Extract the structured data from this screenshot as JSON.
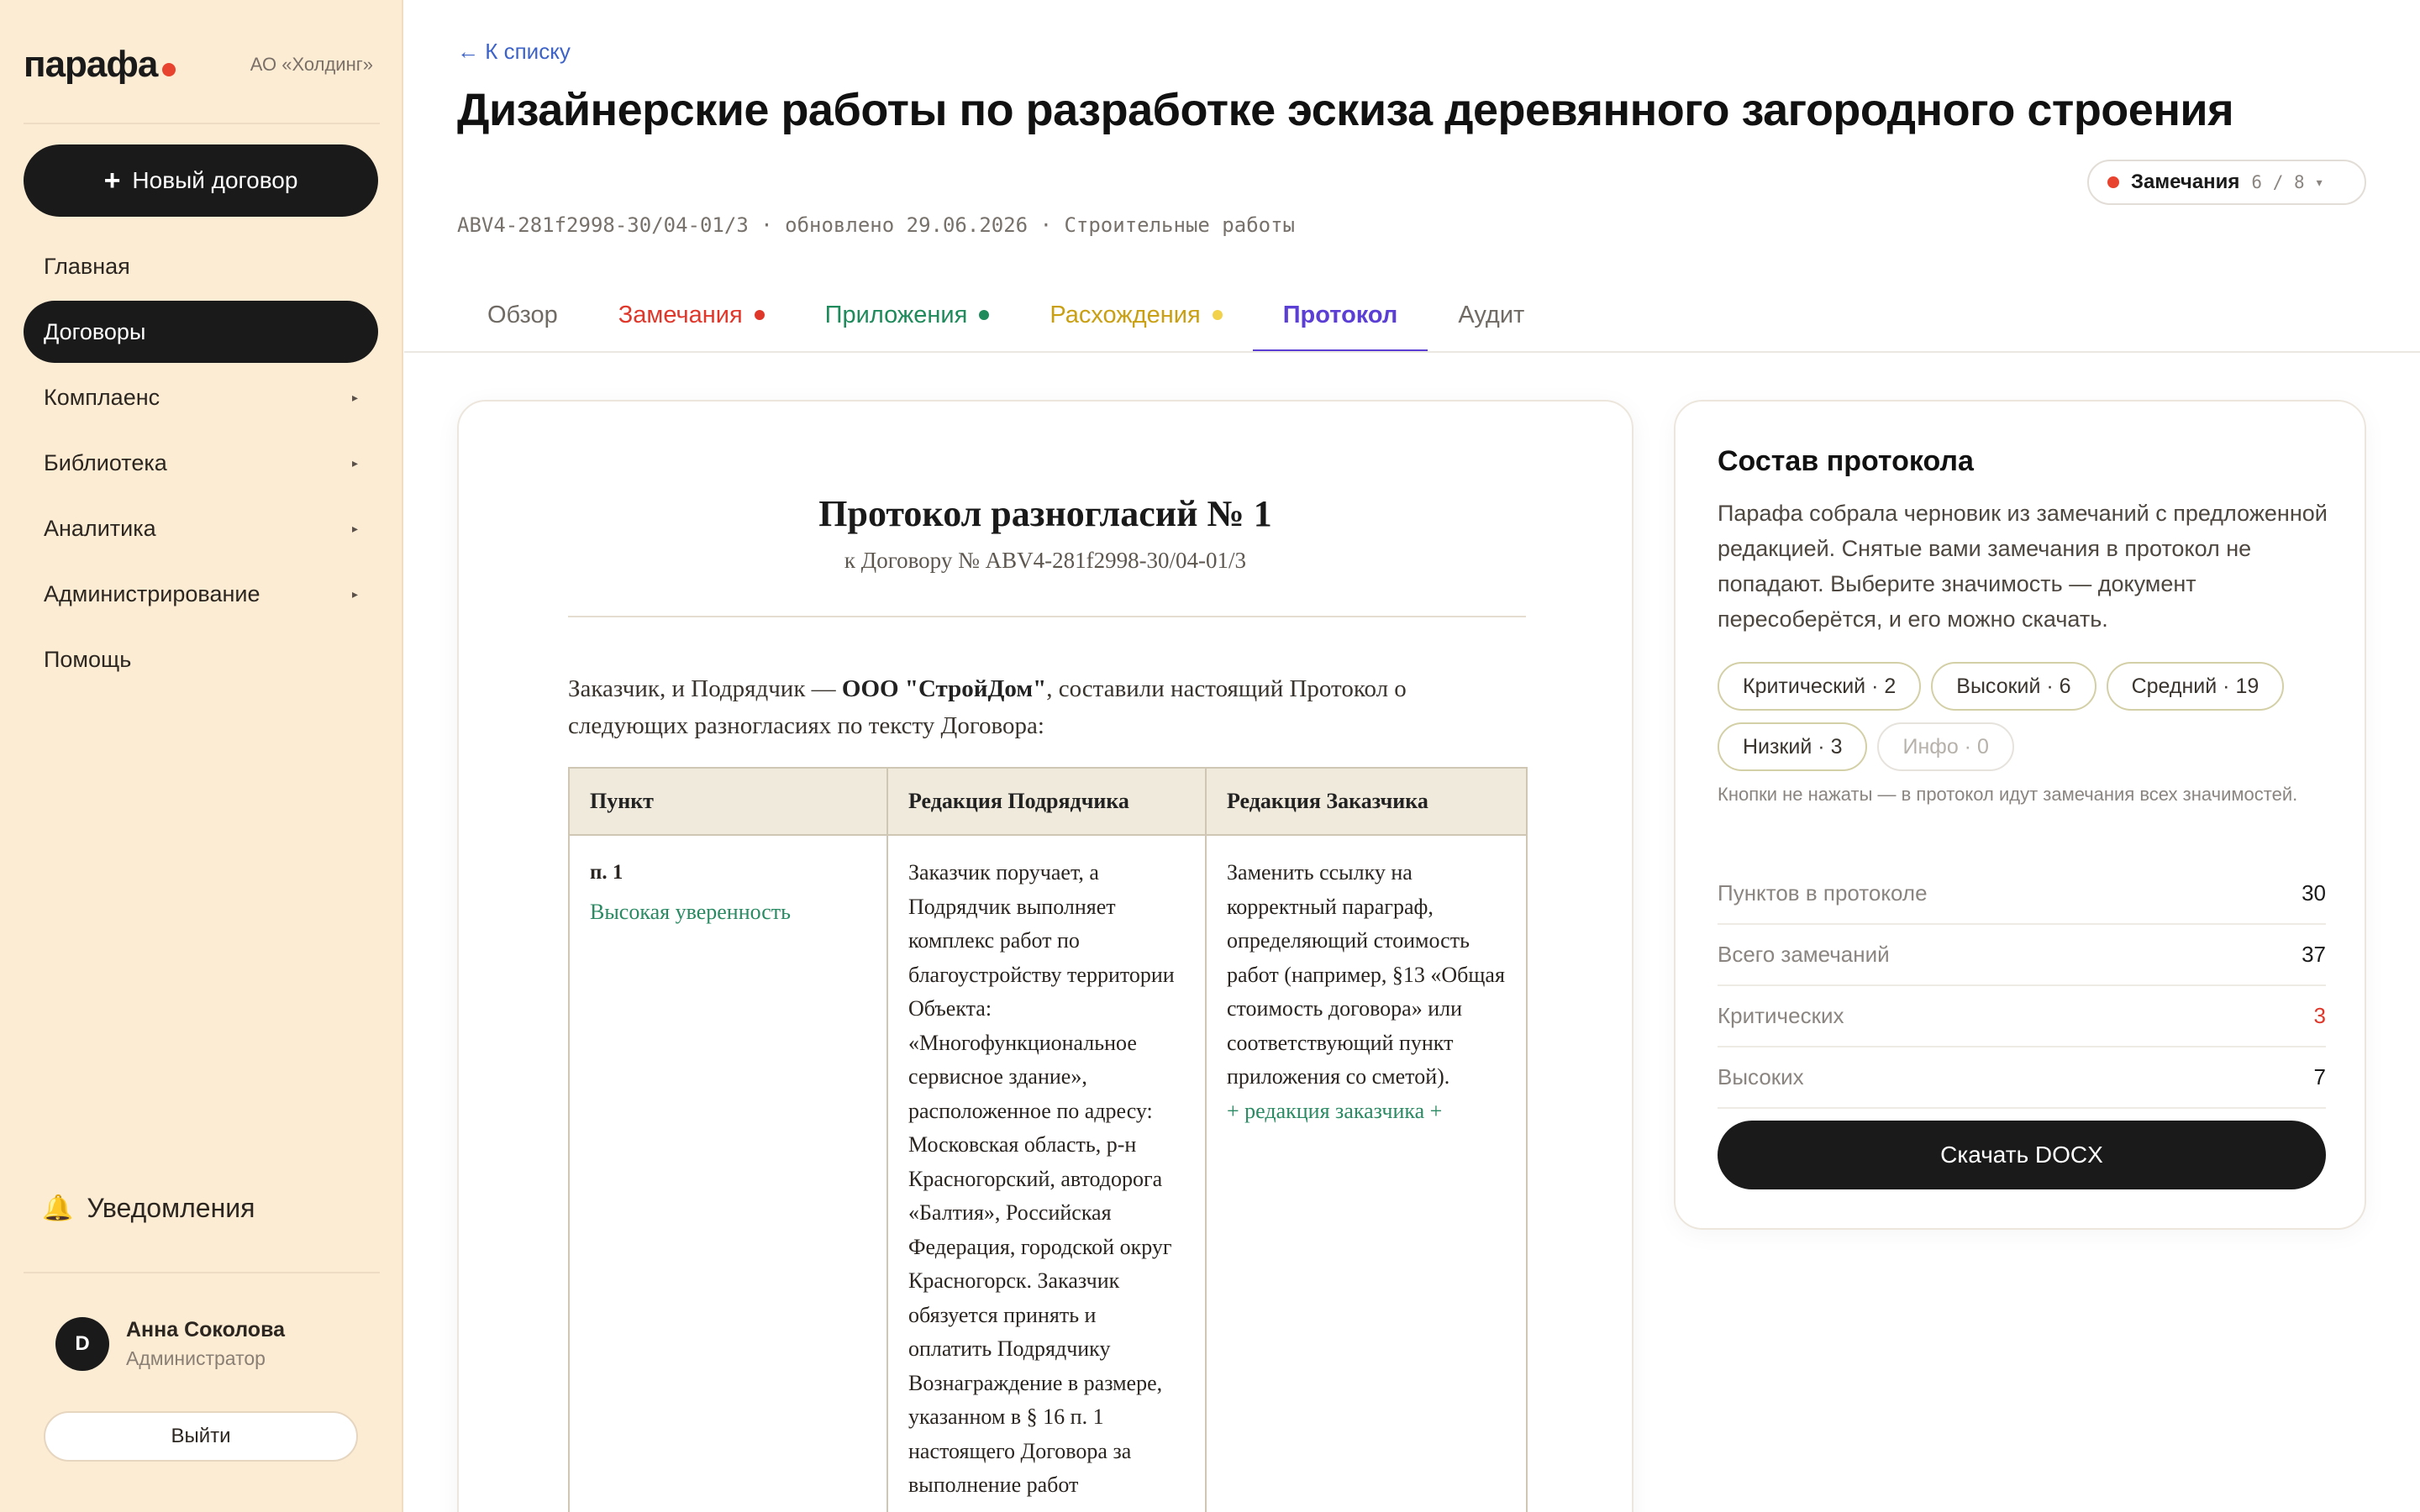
{
  "sidebar": {
    "logo": "парафа",
    "org": "АО «Холдинг»",
    "new_contract_label": "Новый договор",
    "items": [
      {
        "label": "Главная"
      },
      {
        "label": "Договоры"
      },
      {
        "label": "Комплаенс"
      },
      {
        "label": "Библиотека"
      },
      {
        "label": "Аналитика"
      },
      {
        "label": "Администрирование"
      },
      {
        "label": "Помощь"
      }
    ],
    "notifications_label": "Уведомления",
    "user": {
      "initial": "D",
      "name": "Анна Соколова",
      "role": "Администратор"
    },
    "logout_label": "Выйти"
  },
  "header": {
    "back_label": "← К списку",
    "title": "Дизайнерские работы по разработке эскиза деревянного загородного строения",
    "remarks_pill": {
      "label": "Замечания",
      "count": "6 / 8"
    },
    "meta": "ABV4-281f2998-30/04-01/3 · обновлено 29.06.2026 · Строительные работы"
  },
  "tabs": [
    {
      "label": "Обзор"
    },
    {
      "label": "Замечания"
    },
    {
      "label": "Приложения"
    },
    {
      "label": "Расхождения"
    },
    {
      "label": "Протокол"
    },
    {
      "label": "Аудит"
    }
  ],
  "colors": {
    "accent": "#5b3fd4",
    "tab_remarks": "#e0372b",
    "tab_attachments": "#1f8a5b",
    "tab_discrepancies": "#c9a013",
    "tab_discrepancies_dot": "#f2d24a",
    "sidebar_bg": "#fdecd4"
  },
  "document": {
    "title": "Протокол разногласий № 1",
    "subtitle": "к Договору № ABV4-281f2998-30/04-01/3",
    "intro_before": "Заказчик, и Подрядчик — ",
    "intro_party": "ООО \"СтройДом\"",
    "intro_after": ", составили настоящий Протокол о следующих разногласиях по тексту Договора:",
    "columns": [
      "Пункт",
      "Редакция Подрядчика",
      "Редакция Заказчика"
    ],
    "rows": [
      {
        "clause": "п. 1",
        "confidence": "Высокая уверенность",
        "contractor_text": "Заказчик поручает, а Подрядчик выполняет комплекс работ по благоустройству территории Объекта: «Многофункциональное сервисное здание», расположенное по адресу: Московская область, р-н Красногорский, автодорога «Балтия», Российская Федерация, городской округ Красногорск. Заказчик обязуется принять и оплатить Подрядчику Вознаграждение в размере, указанном в § 16 п. 1 настоящего Договора за выполнение работ",
        "customer_text": "Заменить ссылку на корректный параграф, определяющий стоимость работ (например, §13 «Общая стоимость договора» или соответствующий пункт приложения со сметой).",
        "customer_addition": "+ редакция заказчика +"
      }
    ]
  },
  "panel": {
    "title": "Состав протокола",
    "description": "Парафа собрала черновик из замечаний с предложенной редакцией. Снятые вами замечания в протокол не попадают. Выберите значимость — документ пересоберётся, и его можно скачать.",
    "chips": [
      {
        "label": "Критический · 2"
      },
      {
        "label": "Высокий · 6"
      },
      {
        "label": "Средний · 19"
      },
      {
        "label": "Низкий · 3"
      },
      {
        "label": "Инфо · 0"
      }
    ],
    "chip_note": "Кнопки не нажаты — в протокол идут замечания всех значимостей.",
    "stats": [
      {
        "label": "Пунктов в протоколе",
        "value": "30"
      },
      {
        "label": "Всего замечаний",
        "value": "37"
      },
      {
        "label": "Критических",
        "value": "3"
      },
      {
        "label": "Высоких",
        "value": "7"
      }
    ],
    "download_label": "Скачать DOCX"
  }
}
